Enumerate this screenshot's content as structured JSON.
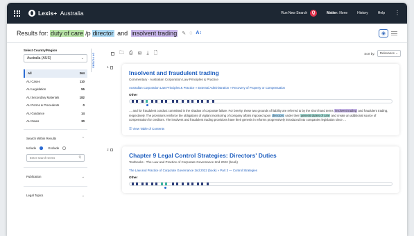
{
  "topbar": {
    "brand": "Lexis+",
    "region": "Australia",
    "new_search": "Run New Search",
    "q_badge": "Q",
    "matter_label": "Matter:",
    "matter_value": "None",
    "history": "History",
    "help": "Help",
    "more": "⋮"
  },
  "results": {
    "prefix": "Results for:",
    "terms": [
      "duty of care",
      "director",
      "insolvent trading"
    ],
    "joiners": [
      "/p",
      "and"
    ],
    "ai_label": "A↕"
  },
  "sidebar": {
    "country_label": "Select Country/Region",
    "country_value": "Australia (AUS)",
    "filters_tab": "OF FILTERS",
    "categories": [
      {
        "label": "All",
        "count": "364"
      },
      {
        "label": "AU Cases",
        "count": "110"
      },
      {
        "label": "AU Legislation",
        "count": "55"
      },
      {
        "label": "AU Secondary Materials",
        "count": "182"
      },
      {
        "label": "AU Forms & Precedents",
        "count": "0"
      },
      {
        "label": "AU Guidance",
        "count": "14"
      },
      {
        "label": "AU News",
        "count": "30"
      }
    ],
    "search_within": "Search Within Results",
    "include": "Include",
    "exclude": "Exclude",
    "search_placeholder": "Enter search terms",
    "publication": "Publication",
    "legal_topics": "Legal Topics"
  },
  "toolbar": {
    "sort_by": "Sort by:",
    "sort_value": "Relevance"
  },
  "result_items": [
    {
      "index": "1",
      "title": "Insolvent and fraudulent trading",
      "subtitle": "Commentary · Australian Corporation Law Principles & Practice",
      "path": "Australian Corporation Law Principles & Practice  »  External Administration  »  Recovery of Property or Compensation",
      "other_label": "Other",
      "snippet_1": "… and for fraudulent conduct committed in the shadow of corporate failure. For brevity, these two grounds of liability are referred to by the short hand terms",
      "snippet_hl_1": "insolvent trading",
      "snippet_2": "and fraudulent trading, respectively. The provisions reinforce the obligations of vigilant monitoring of company affairs imposed upon",
      "snippet_hl_2": "directors",
      "snippet_3": "under their",
      "snippet_hl_3": "general duties of care",
      "snippet_4": "and create an additional source of compensation for creditors. The insolvent and fraudulent trading provisions have their genesis in reforms progressively introduced into companies legislation since …",
      "toc": "View Table of Contents"
    },
    {
      "index": "2",
      "title": "Chapter 9 Legal Control Strategies: Directors' Duties",
      "subtitle": "Textbooks · The Law and Practice of Corporate Governance 2nd 2022 (book)",
      "path": "The Law and Practice of Corporate Governance 2nd 2022 (book)  »  Part 3 — Control Strategies",
      "other_label": "Other"
    }
  ],
  "colors": {
    "topbar": "#1d2733",
    "accent": "#1f5fbf",
    "hit_dark": "#2c3d79",
    "hit_teal": "#3bb3a0",
    "badge_red": "#e0324c"
  }
}
